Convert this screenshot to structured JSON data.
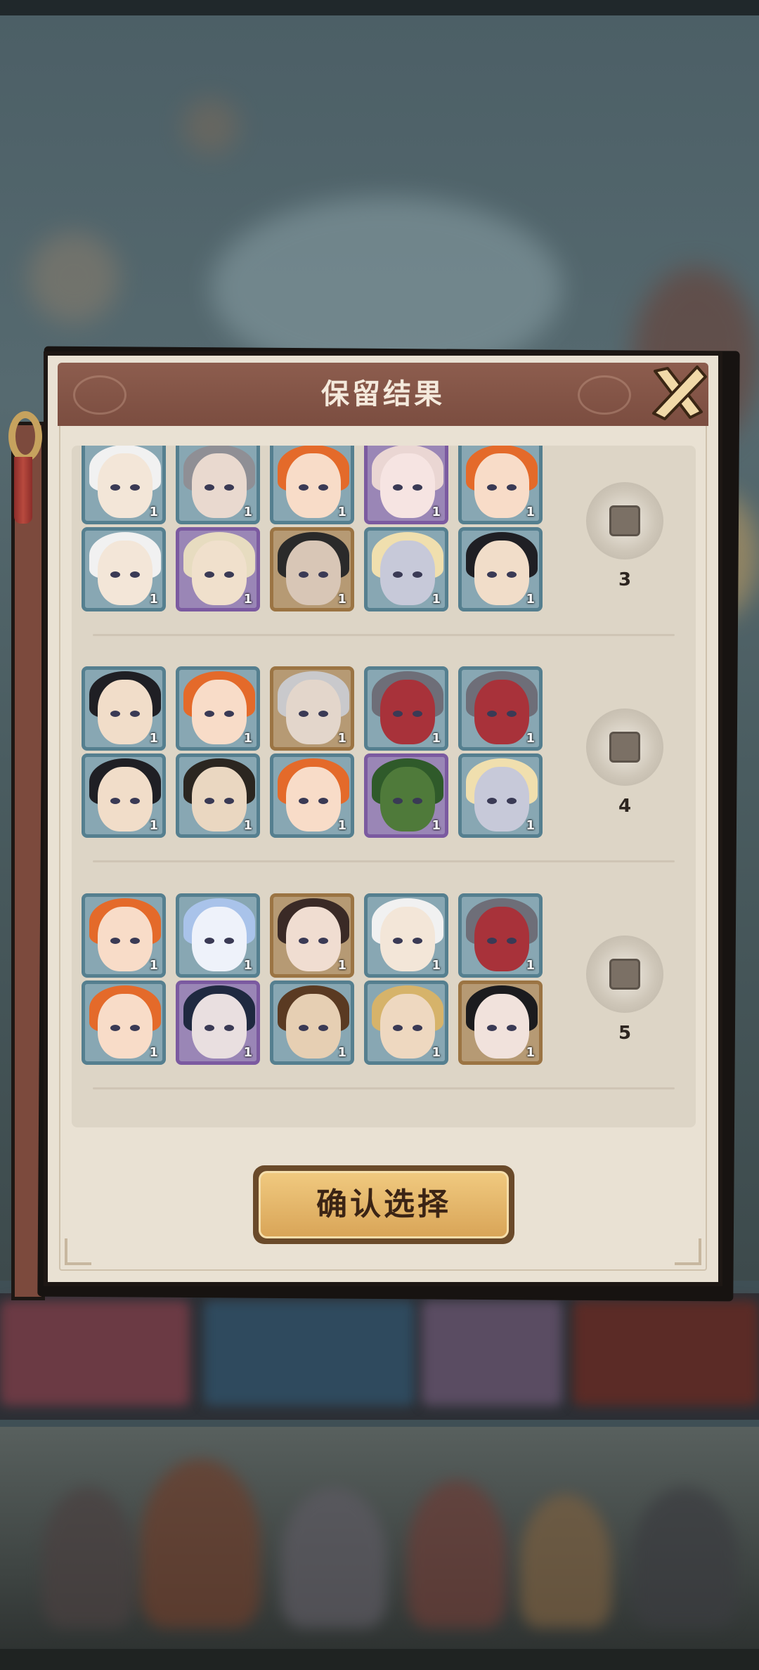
{
  "dialog": {
    "title": "保留结果",
    "confirm_label": "确认选择"
  },
  "groups": [
    {
      "number": "3",
      "rows": [
        [
          {
            "tier": "blue",
            "count": "1",
            "skin": "#f3e6d8",
            "hair": "#f1f1f1"
          },
          {
            "tier": "blue",
            "count": "1",
            "skin": "#e9d9cf",
            "hair": "#8f8f95"
          },
          {
            "tier": "blue",
            "count": "1",
            "skin": "#f8dcc8",
            "hair": "#e46a2a"
          },
          {
            "tier": "purple",
            "count": "1",
            "skin": "#f6e4e2",
            "hair": "#ead6d3"
          },
          {
            "tier": "blue",
            "count": "1",
            "skin": "#f8dcc8",
            "hair": "#e46a2a"
          }
        ],
        [
          {
            "tier": "blue",
            "count": "1",
            "skin": "#f3e6d8",
            "hair": "#f1f1f1"
          },
          {
            "tier": "purple",
            "count": "1",
            "skin": "#f0e0cc",
            "hair": "#e7dcc0"
          },
          {
            "tier": "gold",
            "count": "1",
            "skin": "#d8c6b6",
            "hair": "#2a2a2a"
          },
          {
            "tier": "blue",
            "count": "1",
            "skin": "#c7c9d9",
            "hair": "#f0dfae"
          },
          {
            "tier": "blue",
            "count": "1",
            "skin": "#f1ddc9",
            "hair": "#1f1f24"
          }
        ]
      ]
    },
    {
      "number": "4",
      "rows": [
        [
          {
            "tier": "blue",
            "count": "1",
            "skin": "#f1ddc9",
            "hair": "#1f1f24"
          },
          {
            "tier": "blue",
            "count": "1",
            "skin": "#f8dcc8",
            "hair": "#e46a2a"
          },
          {
            "tier": "gold",
            "count": "1",
            "skin": "#e3d6cb",
            "hair": "#c9c9cc"
          },
          {
            "tier": "blue",
            "count": "1",
            "skin": "#a8323a",
            "hair": "#6e6e78"
          },
          {
            "tier": "blue",
            "count": "1",
            "skin": "#a8323a",
            "hair": "#6e6e78"
          }
        ],
        [
          {
            "tier": "blue",
            "count": "1",
            "skin": "#f1ddc9",
            "hair": "#1f1f24"
          },
          {
            "tier": "blue",
            "count": "1",
            "skin": "#ead7c1",
            "hair": "#2b2620"
          },
          {
            "tier": "blue",
            "count": "1",
            "skin": "#f8dcc8",
            "hair": "#e46a2a"
          },
          {
            "tier": "purple",
            "count": "1",
            "skin": "#4f7a3a",
            "hair": "#2f5a2a"
          },
          {
            "tier": "blue",
            "count": "1",
            "skin": "#c7c9d9",
            "hair": "#f0dfae"
          }
        ]
      ]
    },
    {
      "number": "5",
      "rows": [
        [
          {
            "tier": "blue",
            "count": "1",
            "skin": "#f8dcc8",
            "hair": "#e46a2a"
          },
          {
            "tier": "blue",
            "count": "1",
            "skin": "#eef2fa",
            "hair": "#a9c3ea"
          },
          {
            "tier": "gold",
            "count": "1",
            "skin": "#f0ddd1",
            "hair": "#3a2a26"
          },
          {
            "tier": "blue",
            "count": "1",
            "skin": "#f3e6d8",
            "hair": "#f1f1f1"
          },
          {
            "tier": "blue",
            "count": "1",
            "skin": "#a8323a",
            "hair": "#6e6e78"
          }
        ],
        [
          {
            "tier": "blue",
            "count": "1",
            "skin": "#f8dcc8",
            "hair": "#e46a2a"
          },
          {
            "tier": "purple",
            "count": "1",
            "skin": "#e9dfe0",
            "hair": "#1f2940"
          },
          {
            "tier": "blue",
            "count": "1",
            "skin": "#e6cfb3",
            "hair": "#5a3a22"
          },
          {
            "tier": "blue",
            "count": "1",
            "skin": "#eed8c0",
            "hair": "#d6b36a"
          },
          {
            "tier": "gold",
            "count": "1",
            "skin": "#f1e2dc",
            "hair": "#1b1b1e"
          }
        ]
      ]
    }
  ]
}
